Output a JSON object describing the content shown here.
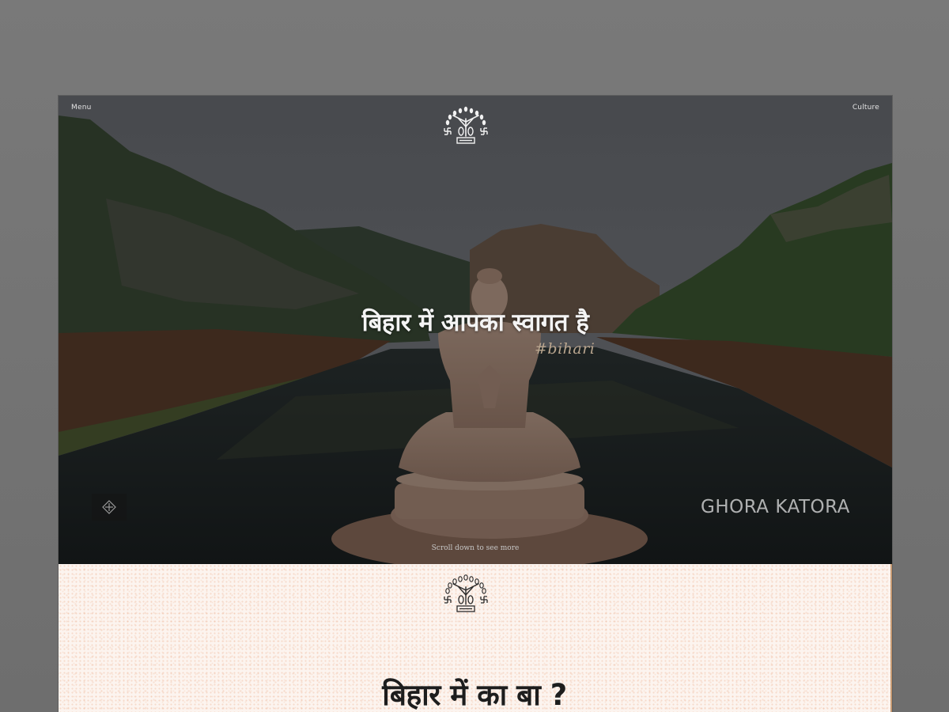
{
  "nav": {
    "menu_label": "Menu",
    "culture_label": "Culture"
  },
  "hero": {
    "title": "बिहार में आपका स्वागत है",
    "hashtag": "#bihari",
    "place_label": "GHORA KATORA",
    "scroll_hint": "Scroll down to see more"
  },
  "section2": {
    "title": "बिहार में का बा ?"
  },
  "logo": {
    "icon": "bodhi-tree-emblem-icon"
  },
  "colors": {
    "hero_overlay": "#3b3d40",
    "section_bg": "#fcf4ef",
    "heading_dark": "#1d1d1d",
    "hashtag": "#b9a58e"
  }
}
